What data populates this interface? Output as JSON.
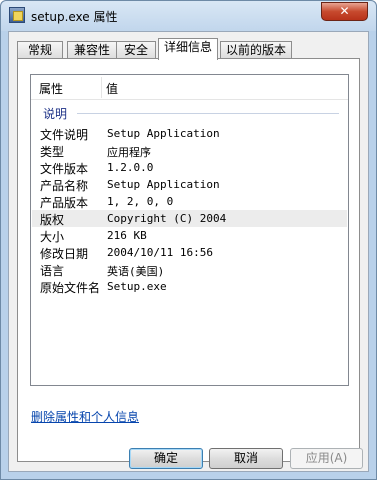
{
  "window": {
    "title": "setup.exe 属性",
    "close_label": "✕"
  },
  "tabs": [
    {
      "label": "常规",
      "active": false
    },
    {
      "label": "兼容性",
      "active": false
    },
    {
      "label": "安全",
      "active": false
    },
    {
      "label": "详细信息",
      "active": true
    },
    {
      "label": "以前的版本",
      "active": false
    }
  ],
  "details": {
    "col_property": "属性",
    "col_value": "值",
    "group": "说明",
    "rows": [
      {
        "key": "文件说明",
        "value": "Setup Application"
      },
      {
        "key": "类型",
        "value": "应用程序"
      },
      {
        "key": "文件版本",
        "value": "1.2.0.0"
      },
      {
        "key": "产品名称",
        "value": "Setup Application"
      },
      {
        "key": "产品版本",
        "value": "1, 2, 0, 0"
      },
      {
        "key": "版权",
        "value": "Copyright (C) 2004",
        "selected": true
      },
      {
        "key": "大小",
        "value": "216 KB"
      },
      {
        "key": "修改日期",
        "value": "2004/10/11 16:56"
      },
      {
        "key": "语言",
        "value": "英语(美国)"
      },
      {
        "key": "原始文件名",
        "value": "Setup.exe"
      }
    ]
  },
  "remove_link": "删除属性和个人信息",
  "buttons": {
    "ok": "确定",
    "cancel": "取消",
    "apply": "应用(A)"
  },
  "colors": {
    "link": "#0645ad",
    "group_label": "#1e3287",
    "selected_row": "#ececec"
  }
}
